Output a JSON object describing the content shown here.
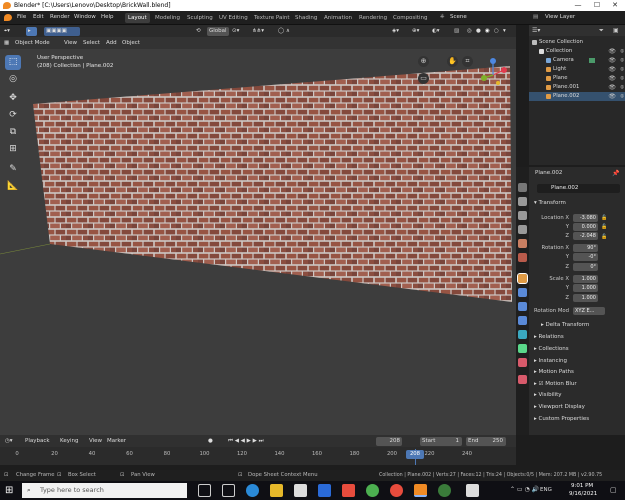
{
  "window": {
    "title": "Blender* [C:\\Users\\Lenovo\\Desktop\\BrickWall.blend]",
    "controls": [
      "—",
      "☐",
      "✕"
    ]
  },
  "menus": [
    "File",
    "Edit",
    "Render",
    "Window",
    "Help"
  ],
  "workspaces": [
    "Layout",
    "Modeling",
    "Sculpting",
    "UV Editing",
    "Texture Paint",
    "Shading",
    "Animation",
    "Rendering",
    "Compositing"
  ],
  "scene_label": "Scene",
  "view_layer_label": "View Layer",
  "viewport": {
    "mode": "Object Mode",
    "menu": [
      "View",
      "Select",
      "Add",
      "Object"
    ],
    "orientation": "Global",
    "info_line1": "User Perspective",
    "info_line2": "(208) Collection | Plane.002"
  },
  "outliner": {
    "title": "Scene Collection",
    "rows": [
      {
        "label": "Collection",
        "color": "#dcdcdc"
      },
      {
        "label": "Camera",
        "color": "#e09b45"
      },
      {
        "label": "Light",
        "color": "#e09b45"
      },
      {
        "label": "Plane",
        "color": "#e09b45"
      },
      {
        "label": "Plane.001",
        "color": "#e09b45"
      },
      {
        "label": "Plane.002",
        "color": "#e09b45"
      }
    ]
  },
  "properties": {
    "object_name": "Plane.002",
    "field_name": "Plane.002",
    "transform": "Transform",
    "location": {
      "label": "Location X",
      "x": "-3.080",
      "y": "0.000",
      "z": "-2.048"
    },
    "rotation": {
      "label": "Rotation X",
      "x": "90°",
      "y": "-0°",
      "z": "0°"
    },
    "scale": {
      "label": "Scale X",
      "x": "1.000",
      "y": "1.000",
      "z": "1.000"
    },
    "y_label": "Y",
    "z_label": "Z",
    "rotation_mode_label": "Rotation Mod",
    "rotation_mode_value": "XYZ E...",
    "sections": [
      "Delta Transform",
      "Relations",
      "Collections",
      "Instancing",
      "Motion Paths",
      "Motion Blur",
      "Visibility",
      "Viewport Display",
      "Custom Properties"
    ]
  },
  "timeline": {
    "menu": [
      "Playback",
      "Keying",
      "View",
      "Marker"
    ],
    "current_frame": "208",
    "start_label": "Start",
    "start": "1",
    "end_label": "End",
    "end": "250",
    "ticks": [
      "0",
      "20",
      "40",
      "60",
      "80",
      "100",
      "120",
      "140",
      "160",
      "180",
      "200",
      "220",
      "240"
    ]
  },
  "statusbar": {
    "left": [
      "Change Frame",
      "Box Select",
      "Pan View"
    ],
    "middle": "Dope Sheet Context Menu",
    "right": "Collection | Plane.002 | Verts:27 | Faces:12 | Tris:24 | Objects:0/5 | Mem: 207.2 MB | v2.90.75"
  },
  "taskbar": {
    "search_placeholder": "Type here to search",
    "time": "9:01 PM",
    "date": "9/16/2021",
    "lang": "ENG"
  }
}
